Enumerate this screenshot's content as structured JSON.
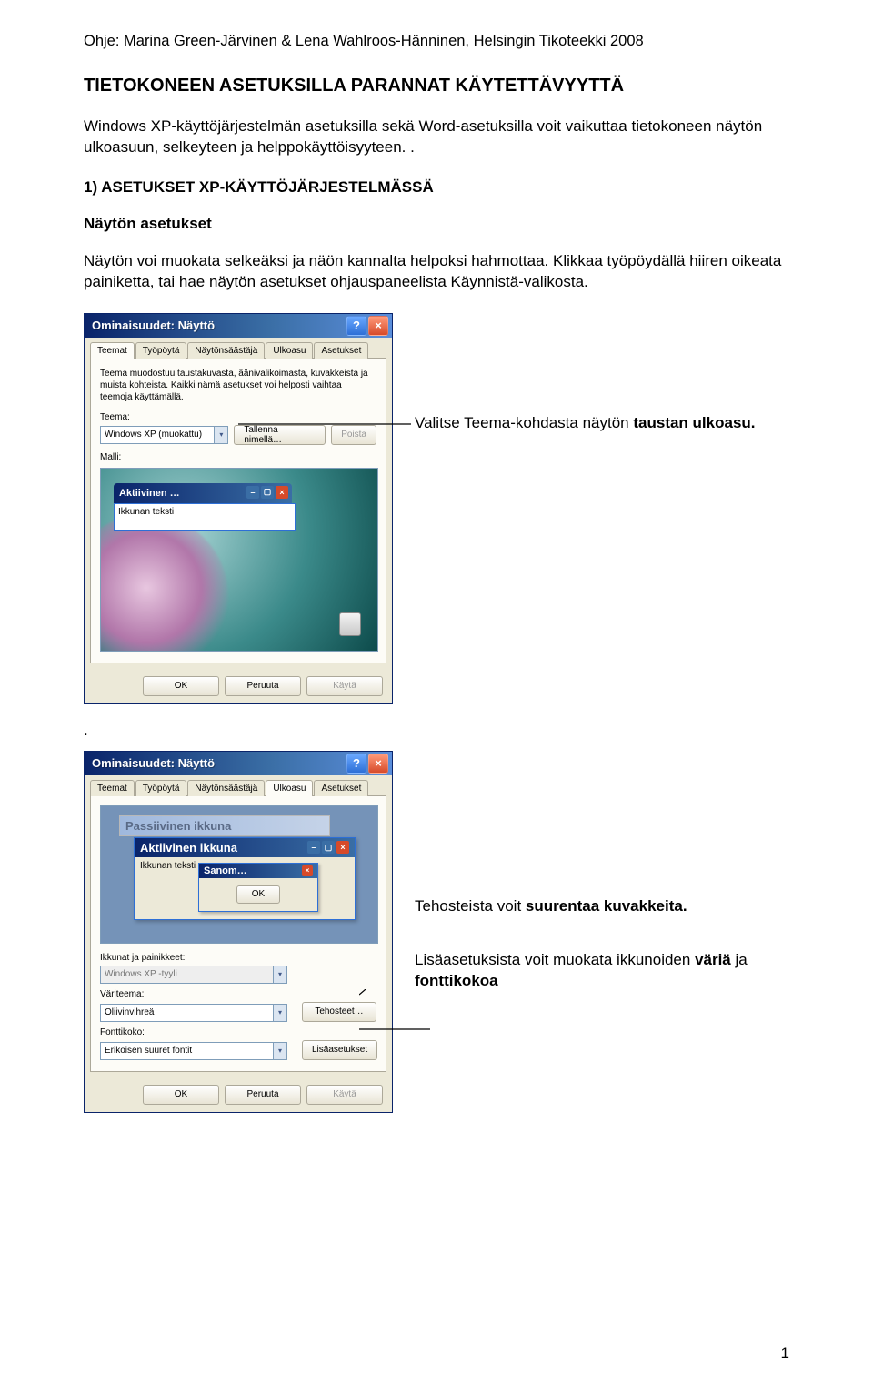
{
  "header": "Ohje: Marina Green-Järvinen & Lena Wahlroos-Hänninen, Helsingin Tikoteekki 2008",
  "title": "TIETOKONEEN ASETUKSILLA PARANNAT KÄYTETTÄVYYTTÄ",
  "intro": "Windows XP-käyttöjärjestelmän asetuksilla sekä Word-asetuksilla voit vaikuttaa tietokoneen näytön ulkoasuun, selkeyteen ja helppokäyttöisyyteen. .",
  "section1": "1)  ASETUKSET XP-KÄYTTÖJÄRJESTELMÄSSÄ",
  "subhead": "Näytön asetukset",
  "para1": "Näytön voi muokata selkeäksi ja näön kannalta helpoksi hahmottaa. Klikkaa työpöydällä hiiren oikeata painiketta, tai hae näytön asetukset ohjauspaneelista Käynnistä-valikosta.",
  "annot1_pre": "Valitse Teema-kohdasta näytön ",
  "annot1_b": "taustan ulkoasu.",
  "dot": ".",
  "annot2_pre": "Tehosteista voit ",
  "annot2_b": "suurentaa kuvakkeita.",
  "annot3_pre": "Lisäasetuksista voit muokata ikkunoiden ",
  "annot3_b1": "väriä",
  "annot3_mid": " ja ",
  "annot3_b2": "fonttikokoa",
  "page_num": "1",
  "dlg1": {
    "title": "Ominaisuudet: Näyttö",
    "tabs": [
      "Teemat",
      "Työpöytä",
      "Näytönsäästäjä",
      "Ulkoasu",
      "Asetukset"
    ],
    "active_tab": 0,
    "desc": "Teema muodostuu taustakuvasta, äänivalikoimasta, kuvakkeista ja muista kohteista. Kaikki nämä asetukset voi helposti vaihtaa teemoja käyttämällä.",
    "teema_label": "Teema:",
    "teema_value": "Windows XP (muokattu)",
    "save_as": "Tallenna nimellä…",
    "delete": "Poista",
    "malli_label": "Malli:",
    "prv_active": "Aktiivinen …",
    "prv_text": "Ikkunan teksti",
    "ok": "OK",
    "cancel": "Peruuta",
    "apply": "Käytä"
  },
  "dlg2": {
    "title": "Ominaisuudet: Näyttö",
    "tabs": [
      "Teemat",
      "Työpöytä",
      "Näytönsäästäjä",
      "Ulkoasu",
      "Asetukset"
    ],
    "active_tab": 3,
    "inactive_title": "Passiivinen ikkuna",
    "active_title": "Aktiivinen ikkuna",
    "active_body": "Ikkunan teksti",
    "msg_title": "Sanom…",
    "msg_ok": "OK",
    "lbl_windows": "Ikkunat ja painikkeet:",
    "val_windows": "Windows XP -tyyli",
    "lbl_color": "Väriteema:",
    "val_color": "Oliivinvihreä",
    "lbl_font": "Fonttikoko:",
    "val_font": "Erikoisen suuret fontit",
    "btn_effects": "Tehosteet…",
    "btn_advanced": "Lisäasetukset",
    "ok": "OK",
    "cancel": "Peruuta",
    "apply": "Käytä"
  }
}
